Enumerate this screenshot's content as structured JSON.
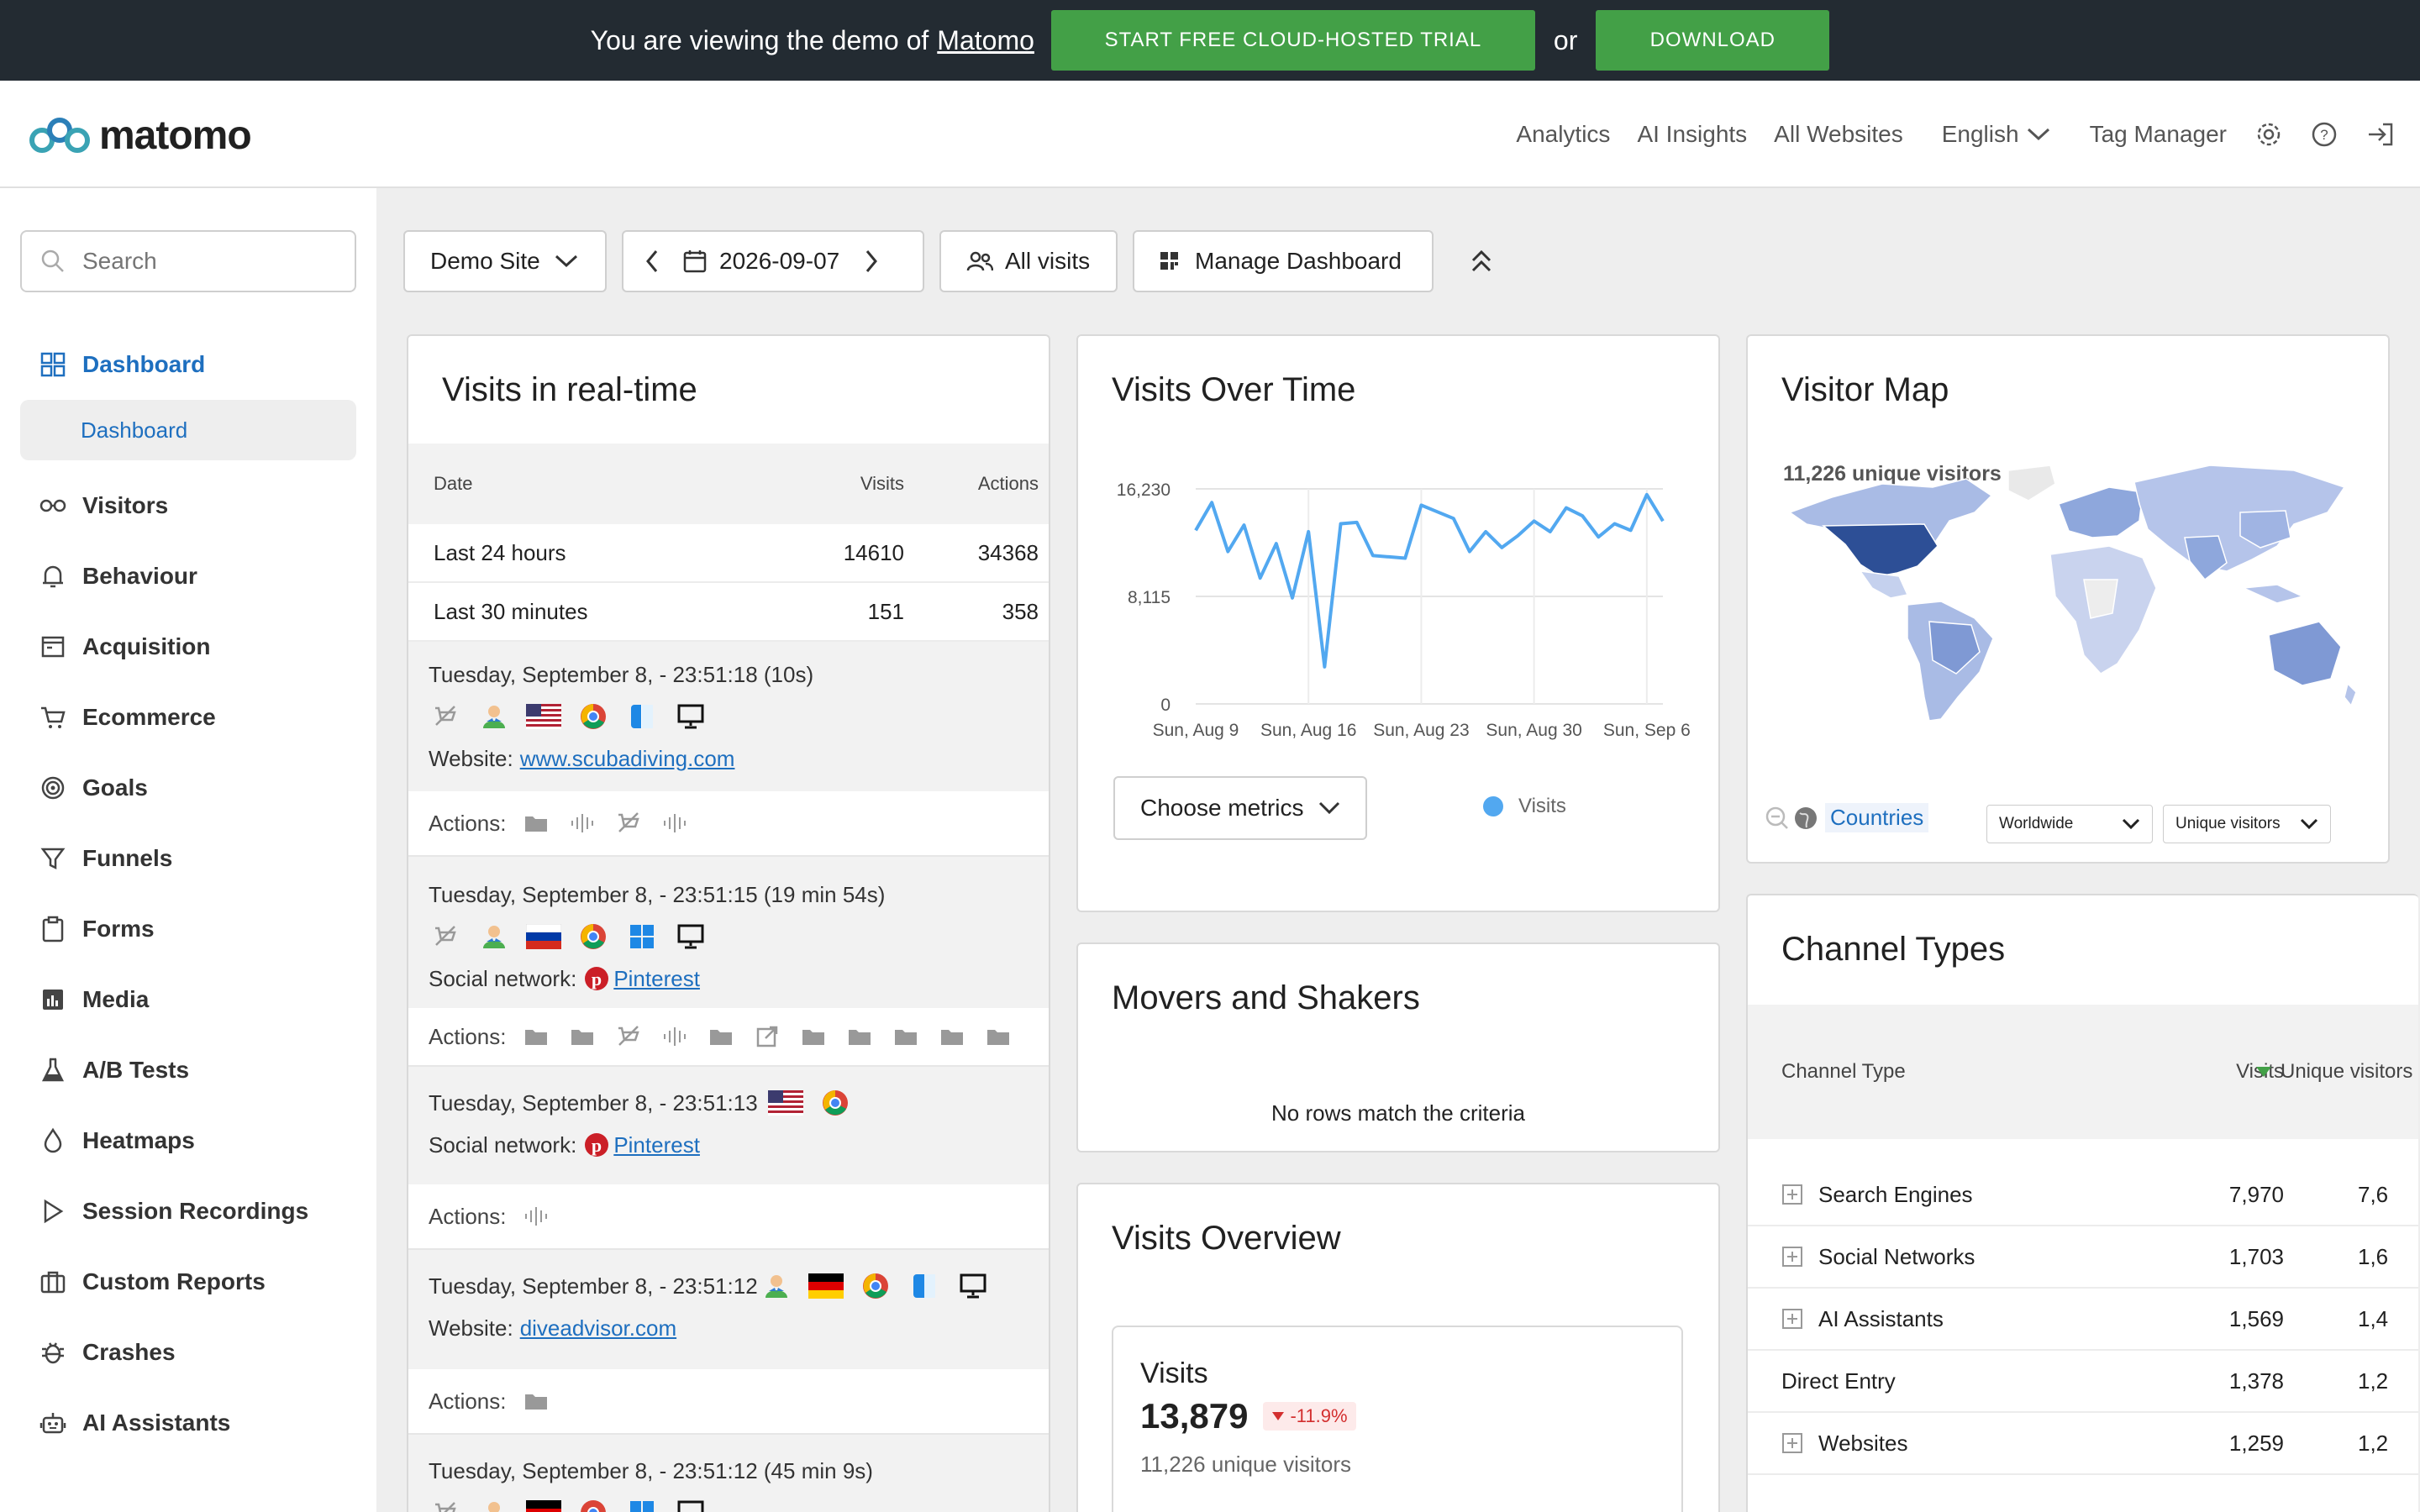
{
  "promo": {
    "text": "You are viewing the demo of",
    "link": "Matomo",
    "trial_button": "START FREE CLOUD-HOSTED TRIAL",
    "or": "or",
    "download_button": "DOWNLOAD",
    "button_color": "#43a047"
  },
  "header": {
    "logo": "matomo",
    "nav": [
      "Analytics",
      "AI Insights",
      "All Websites",
      "English",
      "Tag Manager"
    ],
    "icons": [
      "gear-icon",
      "help-icon",
      "sign-out-icon"
    ]
  },
  "sidebar": {
    "search_placeholder": "Search",
    "items": [
      {
        "label": "Dashboard",
        "icon": "dashboard-icon",
        "active": true,
        "sub": "Dashboard"
      },
      {
        "label": "Visitors",
        "icon": "visitors-icon"
      },
      {
        "label": "Behaviour",
        "icon": "bell-icon"
      },
      {
        "label": "Acquisition",
        "icon": "acquisition-icon"
      },
      {
        "label": "Ecommerce",
        "icon": "cart-icon"
      },
      {
        "label": "Goals",
        "icon": "target-icon"
      },
      {
        "label": "Funnels",
        "icon": "funnel-icon"
      },
      {
        "label": "Forms",
        "icon": "clipboard-icon"
      },
      {
        "label": "Media",
        "icon": "media-icon"
      },
      {
        "label": "A/B Tests",
        "icon": "flask-icon"
      },
      {
        "label": "Heatmaps",
        "icon": "drop-icon"
      },
      {
        "label": "Session Recordings",
        "icon": "play-icon"
      },
      {
        "label": "Custom Reports",
        "icon": "briefcase-icon"
      },
      {
        "label": "Crashes",
        "icon": "bug-icon"
      },
      {
        "label": "AI Assistants",
        "icon": "robot-icon"
      }
    ]
  },
  "controls": {
    "site": "Demo Site",
    "date": "2026-09-07",
    "segment": "All visits",
    "manage": "Manage Dashboard"
  },
  "realtime": {
    "title": "Visits in real-time",
    "headers": [
      "Date",
      "Visits",
      "Actions"
    ],
    "rows": [
      {
        "label": "Last 24 hours",
        "visits": "14610",
        "actions": "34368"
      },
      {
        "label": "Last 30 minutes",
        "visits": "151",
        "actions": "358"
      }
    ],
    "visits": [
      {
        "time": "Tuesday, September 8, - 23:51:18 (10s)",
        "source_label": "Website:",
        "source": "www.scubadiving.com"
      },
      {
        "time": "Tuesday, September 8, - 23:51:15 (19 min 54s)",
        "source_label": "Social network:",
        "source": "Pinterest"
      },
      {
        "time": "Tuesday, September 8, - 23:51:13",
        "source_label": "Social network:",
        "source": "Pinterest"
      },
      {
        "time": "Tuesday, September 8, - 23:51:12",
        "source_label": "Website:",
        "source": "diveadvisor.com"
      },
      {
        "time": "Tuesday, September 8, - 23:51:12 (45 min 9s)"
      }
    ],
    "actions_label": "Actions:"
  },
  "visits_over_time": {
    "title": "Visits Over Time",
    "choose_metrics": "Choose metrics",
    "legend": "Visits",
    "line_color": "#52a8f0"
  },
  "chart_data": {
    "type": "line",
    "x_ticks": [
      "Sun, Aug 9",
      "Sun, Aug 16",
      "Sun, Aug 23",
      "Sun, Aug 30",
      "Sun, Sep 6"
    ],
    "y_ticks": [
      "16,230",
      "8,115",
      "0"
    ],
    "ylim": [
      0,
      16230
    ],
    "series": [
      {
        "name": "Visits",
        "values": [
          13100,
          15200,
          11500,
          13500,
          9500,
          12100,
          8000,
          13000,
          2800,
          13600,
          13700,
          11200,
          11100,
          11000,
          15000,
          14500,
          14000,
          11500,
          13000,
          11800,
          12700,
          13800,
          13000,
          14800,
          14200,
          12600,
          13600,
          13100,
          15800,
          13800
        ]
      }
    ]
  },
  "movers": {
    "title": "Movers and Shakers",
    "empty": "No rows match the criteria"
  },
  "overview": {
    "title": "Visits Overview",
    "metric": "Visits",
    "value": "13,879",
    "change": "-11.9%",
    "sub": "11,226 unique visitors"
  },
  "visitor_map": {
    "title": "Visitor Map",
    "summary": "11,226 unique visitors",
    "countries": "Countries",
    "region": "Worldwide",
    "metric": "Unique visitors"
  },
  "channels": {
    "title": "Channel Types",
    "headers": [
      "Channel Type",
      "Visits",
      "Unique visitors"
    ],
    "rows": [
      {
        "label": "Search Engines",
        "visits": "7,970",
        "unique": "7,6",
        "expand": true
      },
      {
        "label": "Social Networks",
        "visits": "1,703",
        "unique": "1,6",
        "expand": true
      },
      {
        "label": "AI Assistants",
        "visits": "1,569",
        "unique": "1,4",
        "expand": true
      },
      {
        "label": "Direct Entry",
        "visits": "1,378",
        "unique": "1,2",
        "expand": false
      },
      {
        "label": "Websites",
        "visits": "1,259",
        "unique": "1,2",
        "expand": true
      }
    ]
  }
}
